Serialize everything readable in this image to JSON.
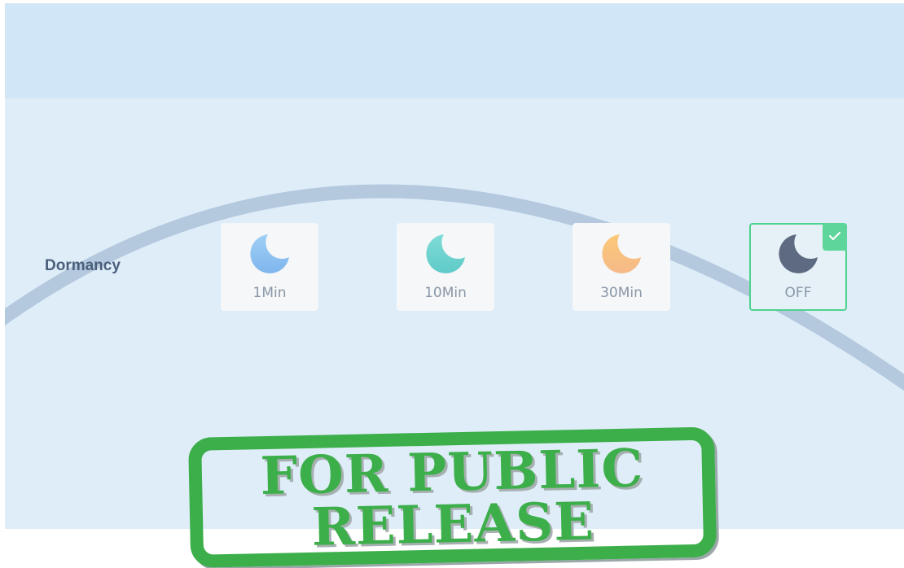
{
  "dormancy": {
    "label": "Dormancy",
    "selected": "OFF",
    "options": [
      {
        "label": "1Min",
        "icon": "moon-icon",
        "color": "#8cc4f2"
      },
      {
        "label": "10Min",
        "icon": "moon-icon",
        "color": "#6fd3cf"
      },
      {
        "label": "30Min",
        "icon": "moon-icon",
        "color": "#f7c07c"
      },
      {
        "label": "OFF",
        "icon": "moon-icon",
        "color": "#5e6a82"
      }
    ]
  },
  "stamp": {
    "line1": "FOR PUBLIC",
    "line2": "RELEASE"
  },
  "colors": {
    "accent": "#4fd28e",
    "stamp": "#3caf4a",
    "background": "#dfedf9",
    "header": "#d1e6f6"
  }
}
